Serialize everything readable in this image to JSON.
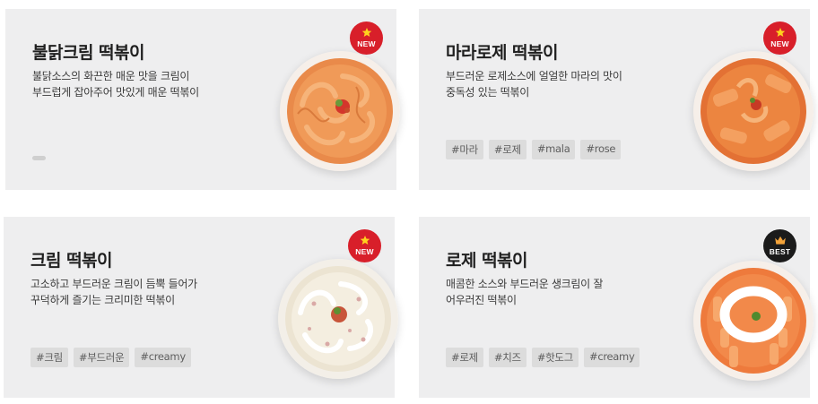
{
  "cards": [
    {
      "title": "불닭크림 떡볶이",
      "description": "불닭소스의 화끈한 매운 맛을 크림이\n부드럽게 잡아주어 맛있게 매운 떡볶이",
      "badge": "NEW",
      "badge_icon": "star-icon",
      "tags": []
    },
    {
      "title": "마라로제 떡볶이",
      "description": "부드러운 로제소스에 얼얼한 마라의 맛이\n중독성 있는 떡볶이",
      "badge": "NEW",
      "badge_icon": "star-icon",
      "tags": [
        "#마라",
        "#로제",
        "#mala",
        "#rose"
      ]
    },
    {
      "title": "크림 떡볶이",
      "description": "고소하고 부드러운 크림이 듬뿍 들어가\n꾸덕하게 즐기는 크리미한 떡볶이",
      "badge": "NEW",
      "badge_icon": "star-icon",
      "tags": [
        "#크림",
        "#부드러운",
        "#creamy"
      ]
    },
    {
      "title": "로제 떡볶이",
      "description": "매콤한 소스와 부드러운 생크림이 잘\n어우러진 떡볶이",
      "badge": "BEST",
      "badge_icon": "crown-icon",
      "tags": [
        "#로제",
        "#치즈",
        "#핫도그",
        "#creamy"
      ]
    }
  ],
  "colors": {
    "card_bg": "#eeeeef",
    "new_badge": "#d81f2a",
    "best_badge": "#1b1b1b",
    "tag_bg": "#dcdcdc",
    "star": "#ffd21e",
    "crown": "#f4a33a"
  }
}
